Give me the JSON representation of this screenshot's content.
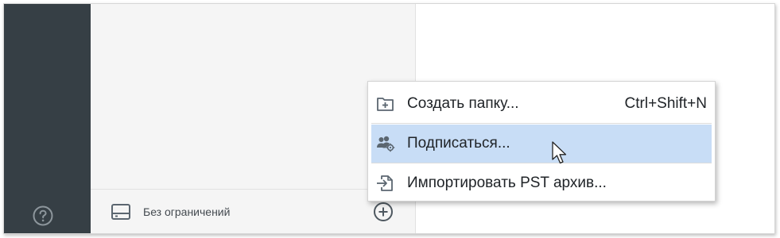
{
  "sidebar": {
    "help_icon": "question-circle-icon"
  },
  "folder_pane": {
    "footer": {
      "storage_icon": "drive-icon",
      "storage_label": "Без ограничений",
      "add_icon": "plus-circle-icon"
    }
  },
  "context_menu": {
    "items": [
      {
        "label": "Создать папку...",
        "shortcut": "Ctrl+Shift+N",
        "icon": "folder-plus-icon",
        "highlighted": false
      },
      {
        "label": "Подписаться...",
        "shortcut": "",
        "icon": "subscribe-users-icon",
        "highlighted": true
      },
      {
        "label": "Импортировать PST архив...",
        "shortcut": "",
        "icon": "import-file-icon",
        "highlighted": false
      }
    ]
  },
  "colors": {
    "rail": "#363f45",
    "pane": "#f5f5f5",
    "highlight": "#c8ddf6",
    "icon": "#5b6670"
  }
}
